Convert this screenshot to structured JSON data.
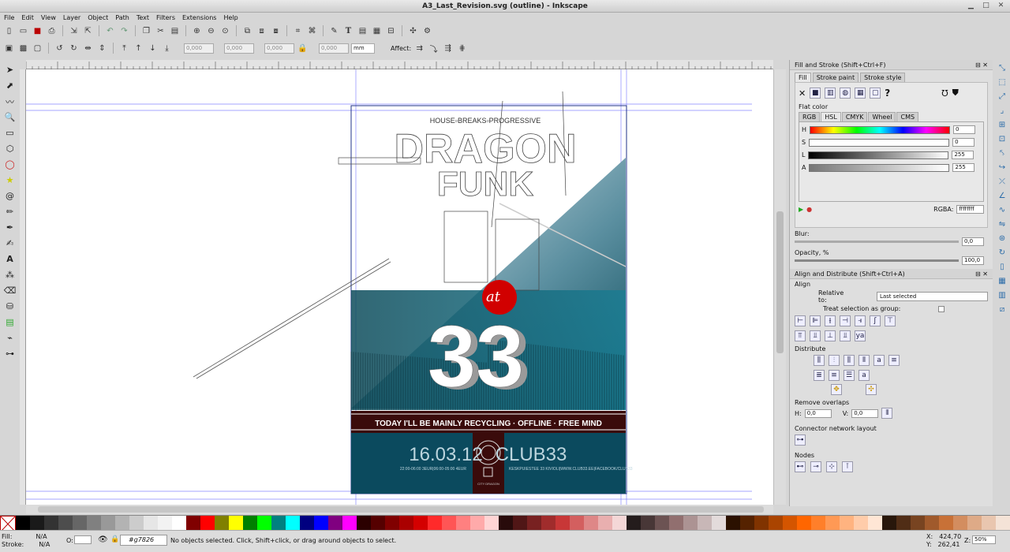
{
  "window": {
    "title": "A3_Last_Revision.svg (outline) - Inkscape"
  },
  "menu": [
    "File",
    "Edit",
    "View",
    "Layer",
    "Object",
    "Path",
    "Text",
    "Filters",
    "Extensions",
    "Help"
  ],
  "toolbar2": {
    "x": "0,000",
    "y": "0,000",
    "w": "0,000",
    "h": "0,000",
    "unit": "mm",
    "affect": "Affect:"
  },
  "poster": {
    "genres": "HOUSE▫BREAKS▫PROGRESSIVE",
    "title1": "DRAGON",
    "title2": "FUNK",
    "at": "at",
    "number": "33",
    "tagline": "TODAY I'LL BE MAINLY RECYCLING · OFFLINE · FREE MIND",
    "date": "16.03.12",
    "times": "22:00-06:00 3EUR|06:00-05:00 4EUR",
    "club": "CLUB33",
    "address": "KESKPUIESTEE 33 KIVIOLI|WWW.CLUB33.EE|FACEBOOK/CLUB33",
    "logo_text": "CITY DRAGON"
  },
  "fill_stroke": {
    "header": "Fill and Stroke (Shift+Ctrl+F)",
    "tabs": [
      "Fill",
      "Stroke paint",
      "Stroke style"
    ],
    "flat_color": "Flat color",
    "mode_tabs": [
      "RGB",
      "HSL",
      "CMYK",
      "Wheel",
      "CMS"
    ],
    "sliders": [
      {
        "label": "H",
        "value": "0"
      },
      {
        "label": "S",
        "value": "0"
      },
      {
        "label": "L",
        "value": "255"
      },
      {
        "label": "A",
        "value": "255"
      }
    ],
    "rgba_label": "RGBA:",
    "rgba": "ffffffff",
    "blur_label": "Blur:",
    "blur": "0,0",
    "opacity_label": "Opacity, %",
    "opacity": "100,0"
  },
  "align": {
    "header": "Align and Distribute (Shift+Ctrl+A)",
    "align_label": "Align",
    "relative_label": "Relative to:",
    "relative_value": "Last selected",
    "treat_label": "Treat selection as group:",
    "distribute_label": "Distribute",
    "remove_overlaps": "Remove overlaps",
    "h_label": "H:",
    "h": "0,0",
    "v_label": "V:",
    "v": "0,0",
    "connector": "Connector network layout",
    "nodes": "Nodes"
  },
  "status": {
    "fill_label": "Fill:",
    "fill": "N/A",
    "stroke_label": "Stroke:",
    "stroke": "N/A",
    "o_label": "O:",
    "layer": "#g7826",
    "message": "No objects selected. Click, Shift+click, or drag around objects to select.",
    "x_label": "X:",
    "x": "424,70",
    "y_label": "Y:",
    "y": "262,41",
    "z_label": "Z:",
    "zoom": "50%"
  },
  "palette": [
    "#000000",
    "#1a1a1a",
    "#333333",
    "#4d4d4d",
    "#666666",
    "#808080",
    "#999999",
    "#b3b3b3",
    "#cccccc",
    "#e6e6e6",
    "#f2f2f2",
    "#ffffff",
    "#800000",
    "#ff0000",
    "#808000",
    "#ffff00",
    "#008000",
    "#00ff00",
    "#008080",
    "#00ffff",
    "#000080",
    "#0000ff",
    "#800080",
    "#ff00ff",
    "#2b0000",
    "#550000",
    "#800000",
    "#aa0000",
    "#d40000",
    "#ff2a2a",
    "#ff5555",
    "#ff8080",
    "#ffaaaa",
    "#ffd5d5",
    "#280b0b",
    "#501616",
    "#782121",
    "#a02c2c",
    "#c83737",
    "#d35f5f",
    "#de8787",
    "#e9afaf",
    "#f4d7d7",
    "#241c1c",
    "#483737",
    "#6c5353",
    "#916f6f",
    "#ac9393",
    "#c8b7b7",
    "#e3dbdb",
    "#2b1100",
    "#552200",
    "#803300",
    "#aa4400",
    "#d45500",
    "#ff6600",
    "#ff7f2a",
    "#ff9955",
    "#ffb380",
    "#ffccaa",
    "#ffe6d5",
    "#28170b",
    "#502d16",
    "#784421",
    "#a05a2c",
    "#c87137",
    "#d38d5f",
    "#deaa87",
    "#e9c6af",
    "#f4e3d7"
  ]
}
